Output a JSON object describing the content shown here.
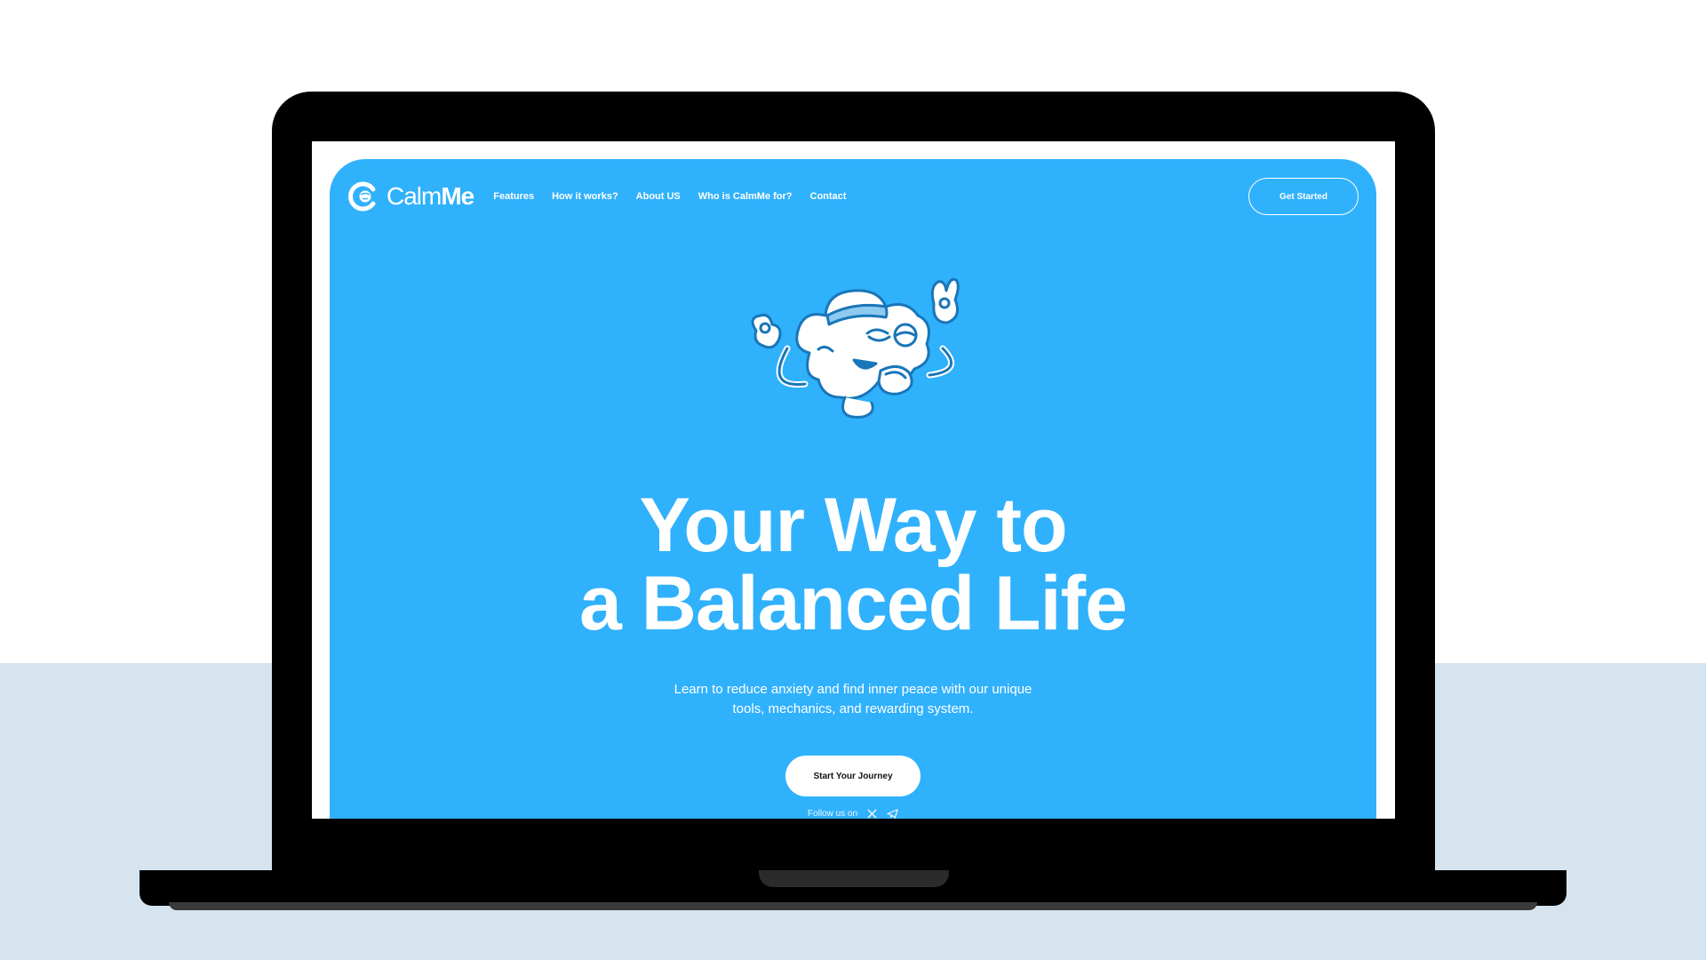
{
  "app": {
    "brand_light": "Calm",
    "brand_bold": "Me"
  },
  "nav": {
    "links": [
      "Features",
      "How it works?",
      "About US",
      "Who is CalmMe for?",
      "Contact"
    ],
    "cta": "Get Started"
  },
  "hero": {
    "title_line1": "Your Way to",
    "title_line2": "a Balanced Life",
    "subtitle_line1": "Learn to reduce anxiety and find inner peace with our unique",
    "subtitle_line2": "tools, mechanics, and rewarding system.",
    "cta": "Start Your Journey",
    "follow_label": "Follow us on"
  },
  "icons": {
    "logo": "calmme-logo-icon",
    "mascot": "meditating-cloud-mascot",
    "social": [
      "x-icon",
      "telegram-icon"
    ]
  },
  "colors": {
    "brand_blue": "#30b1fc",
    "white": "#ffffff",
    "outer_bg_bottom": "#d6e4f0"
  }
}
